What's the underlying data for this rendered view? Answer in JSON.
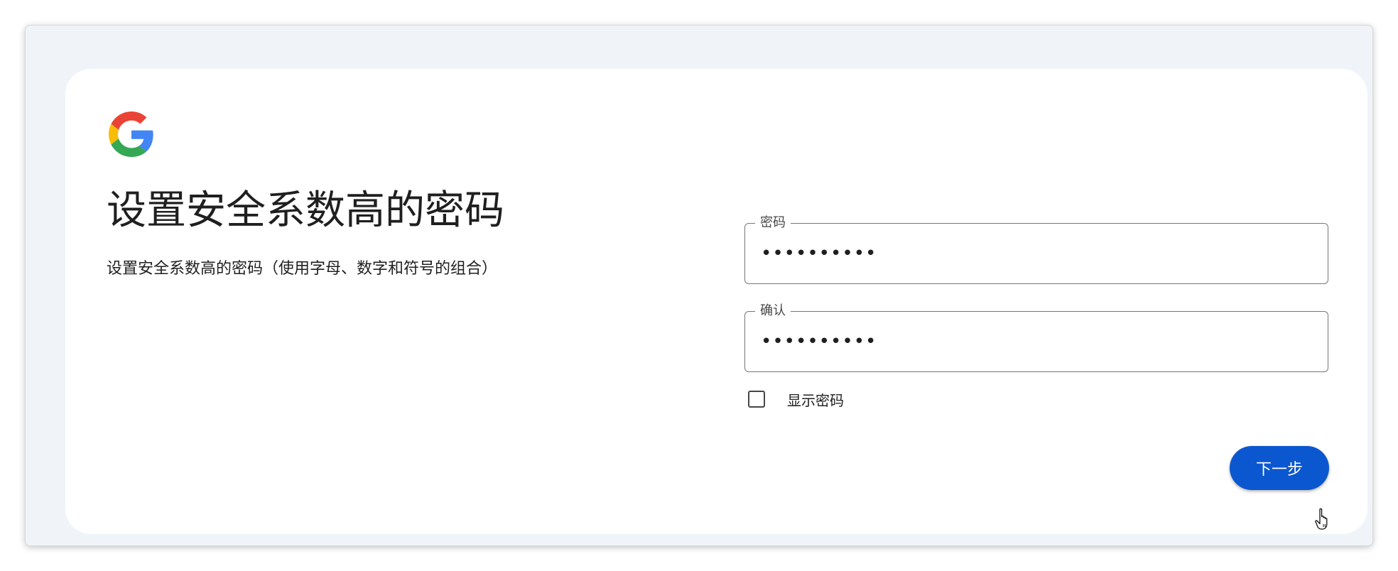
{
  "page": {
    "title": "设置安全系数高的密码",
    "subtitle": "设置安全系数高的密码（使用字母、数字和符号的组合）",
    "logo_icon": "google-g-icon"
  },
  "form": {
    "password": {
      "label": "密码",
      "value": "••••••••••"
    },
    "confirm": {
      "label": "确认",
      "value": "••••••••••"
    },
    "show_password": {
      "label": "显示密码",
      "checked": false
    }
  },
  "actions": {
    "next_label": "下一步"
  },
  "colors": {
    "primary": "#0b57d0",
    "background": "#f0f4f9",
    "card": "#ffffff",
    "google_blue": "#4285F4",
    "google_red": "#EA4335",
    "google_yellow": "#FBBC05",
    "google_green": "#34A853"
  }
}
